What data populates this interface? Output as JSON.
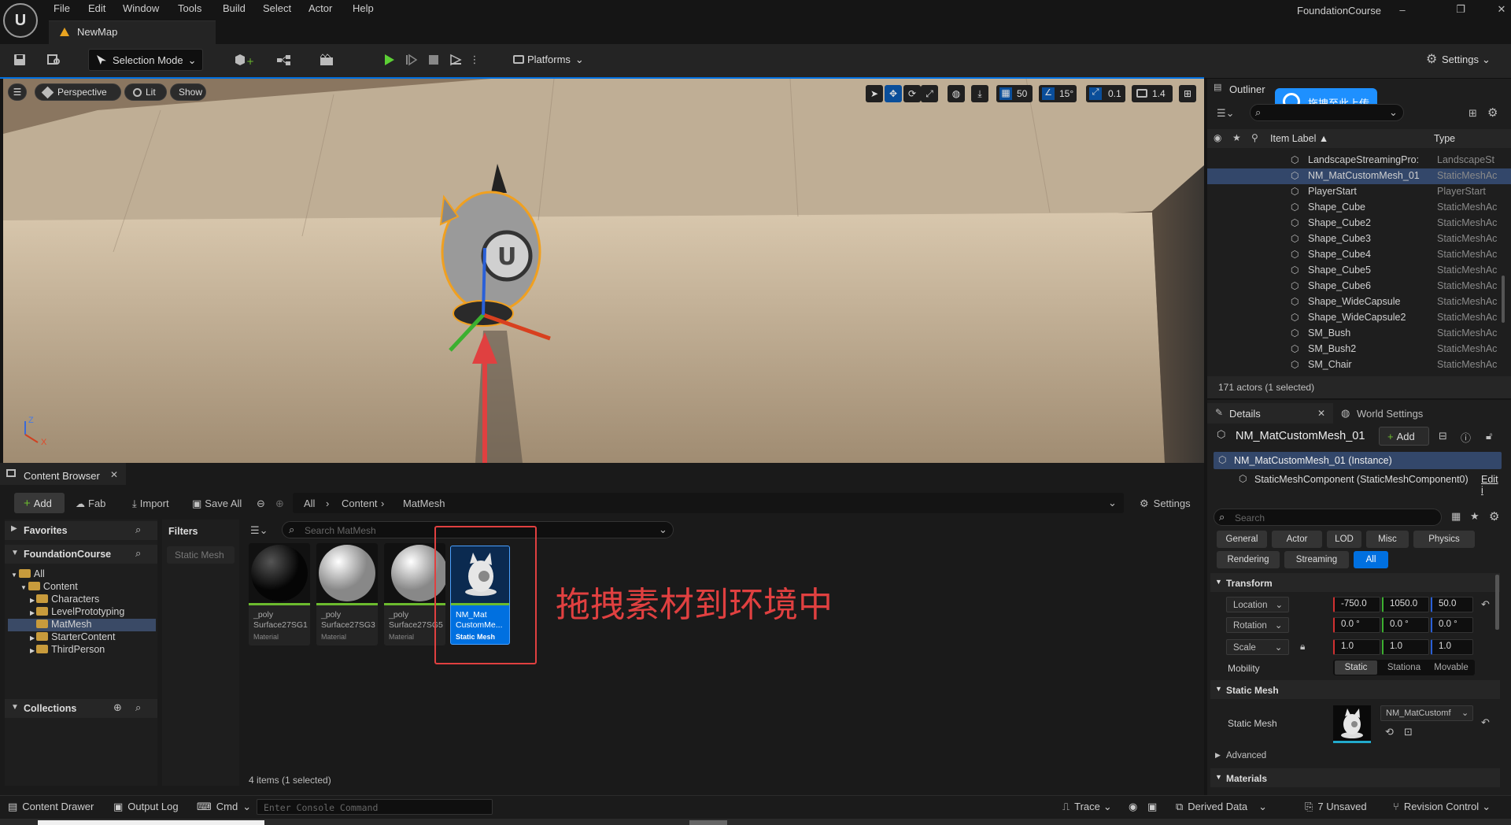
{
  "menu": [
    "File",
    "Edit",
    "Window",
    "Tools",
    "Build",
    "Select",
    "Actor",
    "Help"
  ],
  "app_title": "FoundationCourse",
  "map_tab": "NewMap",
  "toolbar": {
    "selection_mode": "Selection Mode",
    "platforms": "Platforms",
    "settings": "Settings"
  },
  "viewport": {
    "perspective": "Perspective",
    "lit": "Lit",
    "show": "Show",
    "grid_snap": "50",
    "rot_snap": "15°",
    "scale_snap": "0.1",
    "cam_speed": "1.4",
    "axis_z": "Z",
    "axis_x": "X"
  },
  "content_browser": {
    "title": "Content Browser",
    "add": "Add",
    "fab": "Fab",
    "import": "Import",
    "save_all": "Save All",
    "path": [
      "All",
      "Content",
      "MatMesh"
    ],
    "settings": "Settings",
    "favorites": "Favorites",
    "project": "FoundationCourse",
    "filters": "Filters",
    "filter_chip": "Static Mesh",
    "search_placeholder": "Search MatMesh",
    "tree": [
      {
        "label": "All",
        "indent": 0
      },
      {
        "label": "Content",
        "indent": 1
      },
      {
        "label": "Characters",
        "indent": 2
      },
      {
        "label": "LevelPrototyping",
        "indent": 2
      },
      {
        "label": "MatMesh",
        "indent": 2,
        "selected": true
      },
      {
        "label": "StarterContent",
        "indent": 2
      },
      {
        "label": "ThirdPerson",
        "indent": 2
      }
    ],
    "collections": "Collections",
    "assets": [
      {
        "name": "_poly Surface27SG1",
        "type": "Material"
      },
      {
        "name": "_poly Surface27SG3",
        "type": "Material"
      },
      {
        "name": "_poly Surface27SG5",
        "type": "Material"
      },
      {
        "name": "NM_Mat CustomMe...",
        "type": "Static Mesh",
        "selected": true
      }
    ],
    "item_count": "4 items (1 selected)"
  },
  "annotation": "拖拽素材到环境中",
  "outliner": {
    "title": "Outliner",
    "upload_tag": "拖拽至此上传",
    "col_label": "Item Label",
    "col_type": "Type",
    "rows": [
      {
        "name": "LandscapeStreamingPro:",
        "type": "LandscapeSt"
      },
      {
        "name": "NM_MatCustomMesh_01",
        "type": "StaticMeshAc",
        "selected": true
      },
      {
        "name": "PlayerStart",
        "type": "PlayerStart"
      },
      {
        "name": "Shape_Cube",
        "type": "StaticMeshAc"
      },
      {
        "name": "Shape_Cube2",
        "type": "StaticMeshAc"
      },
      {
        "name": "Shape_Cube3",
        "type": "StaticMeshAc"
      },
      {
        "name": "Shape_Cube4",
        "type": "StaticMeshAc"
      },
      {
        "name": "Shape_Cube5",
        "type": "StaticMeshAc"
      },
      {
        "name": "Shape_Cube6",
        "type": "StaticMeshAc"
      },
      {
        "name": "Shape_WideCapsule",
        "type": "StaticMeshAc"
      },
      {
        "name": "Shape_WideCapsule2",
        "type": "StaticMeshAc"
      },
      {
        "name": "SM_Bush",
        "type": "StaticMeshAc"
      },
      {
        "name": "SM_Bush2",
        "type": "StaticMeshAc"
      },
      {
        "name": "SM_Chair",
        "type": "StaticMeshAc"
      }
    ],
    "count": "171 actors (1 selected)"
  },
  "details": {
    "tab": "Details",
    "world_settings": "World Settings",
    "actor": "NM_MatCustomMesh_01",
    "add": "Add",
    "instance": "NM_MatCustomMesh_01 (Instance)",
    "component": "StaticMeshComponent (StaticMeshComponent0)",
    "edit_link": "Edit i",
    "search_placeholder": "Search",
    "categories_row1": [
      "General",
      "Actor",
      "LOD",
      "Misc",
      "Physics"
    ],
    "categories_row2": [
      "Rendering",
      "Streaming",
      "All"
    ],
    "transform": "Transform",
    "location": {
      "label": "Location",
      "x": "-750.0",
      "y": "1050.0",
      "z": "50.0"
    },
    "rotation": {
      "label": "Rotation",
      "x": "0.0 °",
      "y": "0.0 °",
      "z": "0.0 °"
    },
    "scale": {
      "label": "Scale",
      "x": "1.0",
      "y": "1.0",
      "z": "1.0"
    },
    "mobility": "Mobility",
    "mobility_opts": [
      "Static",
      "Stationa",
      "Movable"
    ],
    "static_mesh_section": "Static Mesh",
    "static_mesh_label": "Static Mesh",
    "static_mesh_value": "NM_MatCustomf",
    "advanced": "Advanced",
    "materials": "Materials"
  },
  "statusbar": {
    "content_drawer": "Content Drawer",
    "output_log": "Output Log",
    "cmd": "Cmd",
    "console_placeholder": "Enter Console Command",
    "trace": "Trace",
    "derived_data": "Derived Data",
    "unsaved": "7 Unsaved",
    "revision": "Revision Control"
  },
  "colors": {
    "accent": "#0070e0",
    "play": "#5ccf35",
    "annotation": "#e04040"
  }
}
